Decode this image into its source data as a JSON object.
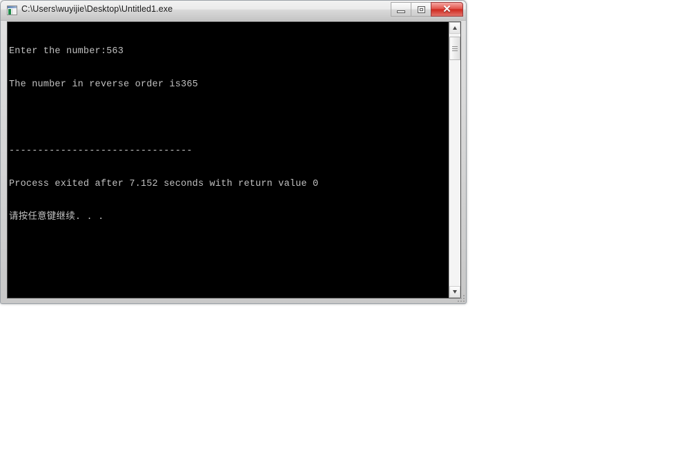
{
  "window": {
    "title": "C:\\Users\\wuyijie\\Desktop\\Untitled1.exe",
    "icon": "console-app-icon",
    "controls": {
      "minimize_label": "–",
      "maximize_label": "□",
      "close_label": "✕"
    },
    "frame_color": "#d4d4d4",
    "titlebar_color": "#eaeaea",
    "close_button_color": "#cf2a20"
  },
  "console": {
    "background_color": "#000000",
    "text_color": "#c0c0c0",
    "lines": [
      "Enter the number:563",
      "The number in reverse order is365",
      "",
      "--------------------------------",
      "Process exited after 7.152 seconds with return value 0",
      "请按任意键继续. . ."
    ]
  },
  "scrollbar": {
    "up_arrow": "scroll-up-arrow",
    "down_arrow": "scroll-down-arrow",
    "thumb": "scroll-thumb"
  }
}
